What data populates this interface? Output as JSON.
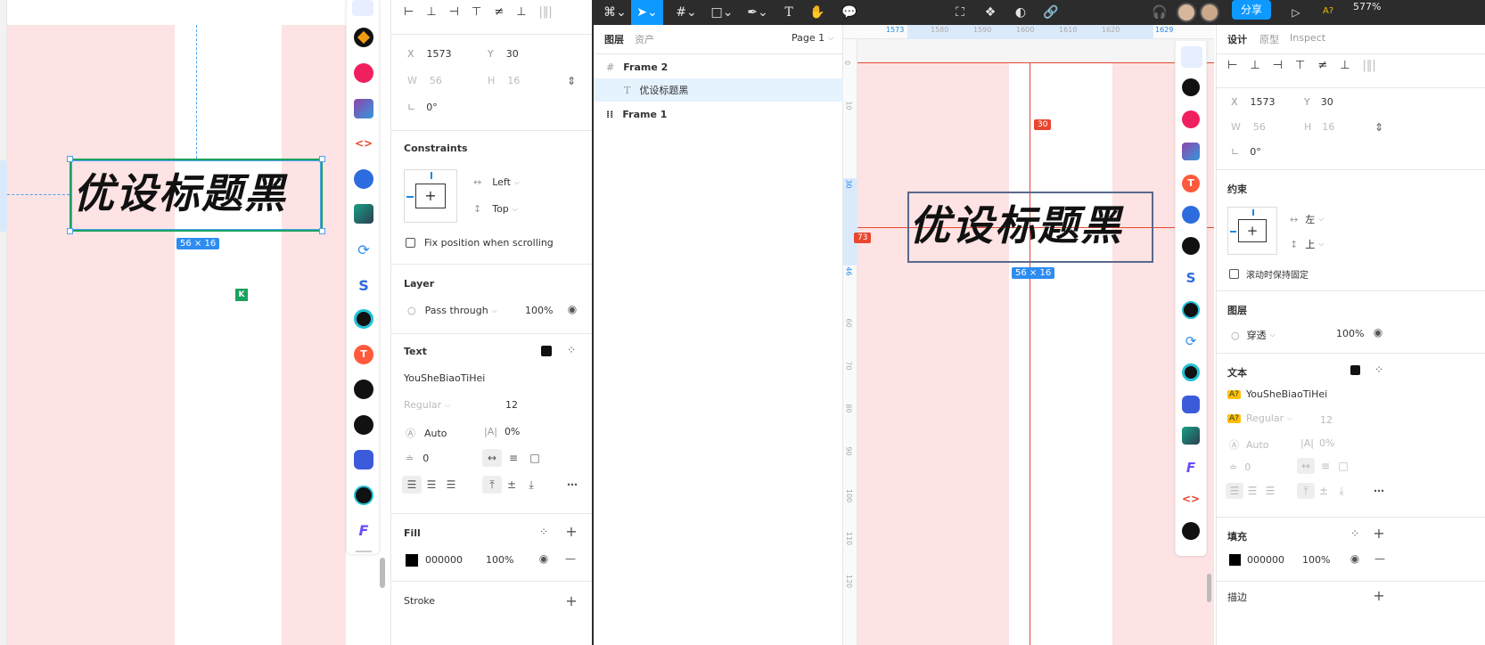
{
  "left_canvas": {
    "headline": "优设标题黑",
    "size_badge": "56 × 16",
    "k_badge": "K"
  },
  "left_panel": {
    "x_label": "X",
    "x_value": "1573",
    "y_label": "Y",
    "y_value": "30",
    "w_label": "W",
    "w_value": "56",
    "h_label": "H",
    "h_value": "16",
    "rotation": "0°",
    "constraints_title": "Constraints",
    "constraint_h": "Left",
    "constraint_v": "Top",
    "fix_position": "Fix position when scrolling",
    "layer_title": "Layer",
    "blend_mode": "Pass through",
    "opacity": "100%",
    "text_title": "Text",
    "font_family": "YouSheBiaoTiHei",
    "font_style": "Regular",
    "font_size": "12",
    "line_height": "Auto",
    "letter_spacing": "0%",
    "para_spacing": "0",
    "fill_title": "Fill",
    "fill_hex": "000000",
    "fill_opacity": "100%",
    "stroke_title": "Stroke"
  },
  "toolbar": {
    "share_label": "分享",
    "zoom": "577%",
    "badge": "A?"
  },
  "layers_panel": {
    "tab_layers": "图层",
    "tab_assets": "资产",
    "page_selector": "Page 1",
    "layers": [
      {
        "name": "Frame 2",
        "type": "frame"
      },
      {
        "name": "优设标题黑",
        "type": "text"
      },
      {
        "name": "Frame 1",
        "type": "component"
      }
    ]
  },
  "ruler": {
    "top_labels": [
      "1573",
      "1580",
      "1590",
      "1600",
      "1610",
      "1620",
      "1629"
    ],
    "side_labels": [
      "0",
      "10",
      "30",
      "46",
      "60",
      "70",
      "80",
      "90",
      "100",
      "110",
      "120"
    ]
  },
  "canvas": {
    "headline": "优设标题黑",
    "size_badge": "56 × 16",
    "spacing_top": "30",
    "spacing_left": "73"
  },
  "right_panel": {
    "tab_design": "设计",
    "tab_prototype": "原型",
    "tab_inspect": "Inspect",
    "x_label": "X",
    "x_value": "1573",
    "y_label": "Y",
    "y_value": "30",
    "w_label": "W",
    "w_value": "56",
    "h_label": "H",
    "h_value": "16",
    "rotation": "0°",
    "constraints_title": "约束",
    "constraint_h": "左",
    "constraint_v": "上",
    "fix_position": "滚动时保持固定",
    "layer_title": "图层",
    "blend_mode": "穿透",
    "opacity": "100%",
    "text_title": "文本",
    "missing_badge": "A?",
    "font_family": "YouSheBiaoTiHei",
    "font_style": "Regular",
    "font_size": "12",
    "line_height": "Auto",
    "letter_spacing": "0%",
    "para_spacing": "0",
    "fill_title": "填充",
    "fill_hex": "000000",
    "fill_opacity": "100%",
    "stroke_title": "描边"
  },
  "colors": {
    "accent": "#1e88e5",
    "canvas_pink": "#fde3e3",
    "guide_red": "#e8462f",
    "selection_green": "#1aa260",
    "toolbar_bg": "#2c2c2c"
  }
}
